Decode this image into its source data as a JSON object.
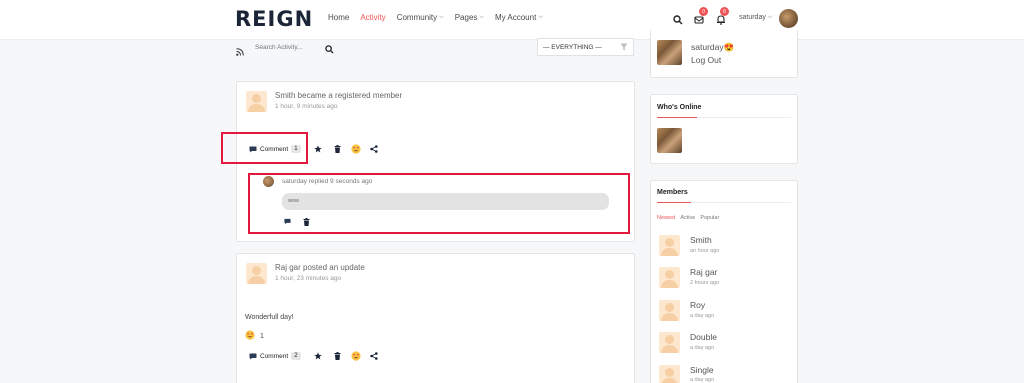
{
  "header": {
    "logo": "REIGN",
    "nav": [
      {
        "label": "Home",
        "active": false,
        "dropdown": false
      },
      {
        "label": "Activity",
        "active": true,
        "dropdown": false
      },
      {
        "label": "Community",
        "active": false,
        "dropdown": true
      },
      {
        "label": "Pages",
        "active": false,
        "dropdown": true
      },
      {
        "label": "My Account",
        "active": false,
        "dropdown": true
      }
    ],
    "messages_badge": "0",
    "notifications_badge": "8",
    "user_name": "saturday",
    "accent_color": "#ef5455"
  },
  "search": {
    "placeholder": "Search Activity...",
    "filter_value": "— EVERYTHING —"
  },
  "activity": [
    {
      "title": "Smith became a registered member",
      "time": "1 hour, 9 minutes ago",
      "comment_label": "Comment",
      "comment_count": "1",
      "reply": {
        "meta": "saturday replied 9 seconds ago",
        "text": "wow"
      }
    },
    {
      "title": "Raj gar posted an update",
      "time": "1 hour, 23 minutes ago",
      "text": "Wonderfull day!",
      "reaction_count": "1",
      "comment_label": "Comment",
      "comment_count": "2"
    }
  ],
  "sidebar": {
    "profile": {
      "name": "saturday😍",
      "logout": "Log Out"
    },
    "whos_online": {
      "title": "Who's Online"
    },
    "members": {
      "title": "Members",
      "tabs": [
        "Newest",
        "Active",
        "Popular"
      ],
      "active_tab": "Newest",
      "list": [
        {
          "name": "Smith",
          "time": "an hour ago"
        },
        {
          "name": "Raj gar",
          "time": "2 hours ago"
        },
        {
          "name": "Roy",
          "time": "a day ago"
        },
        {
          "name": "Double",
          "time": "a day ago"
        },
        {
          "name": "Single",
          "time": "a day ago"
        }
      ]
    }
  },
  "icons": [
    "search-icon",
    "message-icon",
    "bell-icon",
    "rss-icon",
    "comment-icon",
    "star-icon",
    "trash-icon",
    "emoji-icon",
    "share-icon",
    "funnel-icon"
  ]
}
